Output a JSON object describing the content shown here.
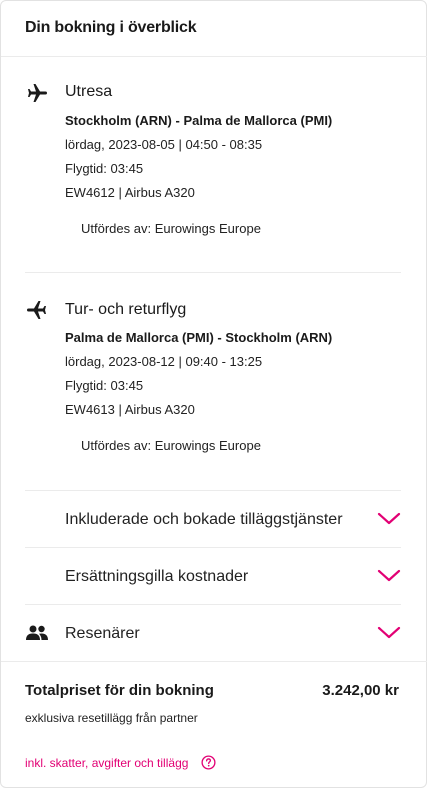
{
  "summary": {
    "title": "Din bokning i överblick"
  },
  "outbound": {
    "icon": "airplane-icon",
    "title": "Utresa",
    "route": "Stockholm (ARN) - Palma de Mallorca (PMI)",
    "datetime": "lördag, 2023-08-05 | 04:50 - 08:35",
    "duration": "Flygtid: 03:45",
    "flight": "EW4612 | Airbus A320",
    "operated_by": "Utfördes av: Eurowings Europe"
  },
  "return": {
    "icon": "airplane-icon",
    "title": "Tur- och returflyg",
    "route": "Palma de Mallorca (PMI) - Stockholm (ARN)",
    "datetime": "lördag, 2023-08-12 | 09:40 - 13:25",
    "duration": "Flygtid: 03:45",
    "flight": "EW4613 | Airbus A320",
    "operated_by": "Utfördes av: Eurowings Europe"
  },
  "accordions": [
    {
      "label": "Inkluderade och bokade tilläggstjänster",
      "icon": "chevron-down-icon"
    },
    {
      "label": "Ersättningsgilla kostnader",
      "icon": "chevron-down-icon"
    },
    {
      "label": "Resenärer",
      "icon": "chevron-down-icon",
      "leading_icon": "people-icon"
    }
  ],
  "total": {
    "label": "Totalpriset för din bokning",
    "value": "3.242,00 kr",
    "note": "exklusiva resetillägg från partner",
    "link": "inkl. skatter, avgifter och tillägg",
    "help_icon": "help-icon"
  },
  "colors": {
    "accent": "#e20074",
    "text": "#1a1a1a",
    "divider": "#ebebeb"
  }
}
